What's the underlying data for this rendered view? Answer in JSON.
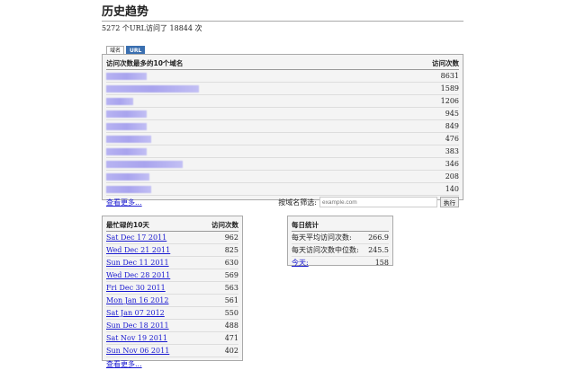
{
  "title": "历史趋势",
  "summary": "5272 个URL访问了 18844 次",
  "tabs": [
    {
      "label": "域名"
    },
    {
      "label": "URL"
    }
  ],
  "domains": {
    "header_name": "访问次数最多的10个域名",
    "header_count": "访问次数",
    "rows": [
      {
        "count": "8631",
        "bar": 45
      },
      {
        "count": "1589",
        "bar": 103
      },
      {
        "count": "1206",
        "bar": 30
      },
      {
        "count": "945",
        "bar": 45
      },
      {
        "count": "849",
        "bar": 45
      },
      {
        "count": "476",
        "bar": 50
      },
      {
        "count": "383",
        "bar": 45
      },
      {
        "count": "346",
        "bar": 85
      },
      {
        "count": "208",
        "bar": 48
      },
      {
        "count": "140",
        "bar": 50
      }
    ],
    "more": "查看更多...",
    "filter_label": "按域名筛选:",
    "filter_placeholder": "example.com",
    "filter_button": "执行"
  },
  "busiest": {
    "header_name": "最忙碌的10天",
    "header_count": "访问次数",
    "rows": [
      {
        "date": "Sat Dec 17 2011",
        "count": "962"
      },
      {
        "date": "Wed Dec 21 2011",
        "count": "825"
      },
      {
        "date": "Sun Dec 11 2011",
        "count": "630"
      },
      {
        "date": "Wed Dec 28 2011",
        "count": "569"
      },
      {
        "date": "Fri Dec 30 2011",
        "count": "563"
      },
      {
        "date": "Mon Jan 16 2012",
        "count": "561"
      },
      {
        "date": "Sat Jan 07 2012",
        "count": "550"
      },
      {
        "date": "Sun Dec 18 2011",
        "count": "488"
      },
      {
        "date": "Sat Nov 19 2011",
        "count": "471"
      },
      {
        "date": "Sun Nov 06 2011",
        "count": "402"
      }
    ],
    "more": "查看更多..."
  },
  "daily": {
    "header": "每日统计",
    "avg_label": "每天平均访问次数:",
    "avg": "266.9",
    "median_label": "每天访问次数中位数:",
    "median": "245.5",
    "today_label": "今天:",
    "today": "158"
  }
}
